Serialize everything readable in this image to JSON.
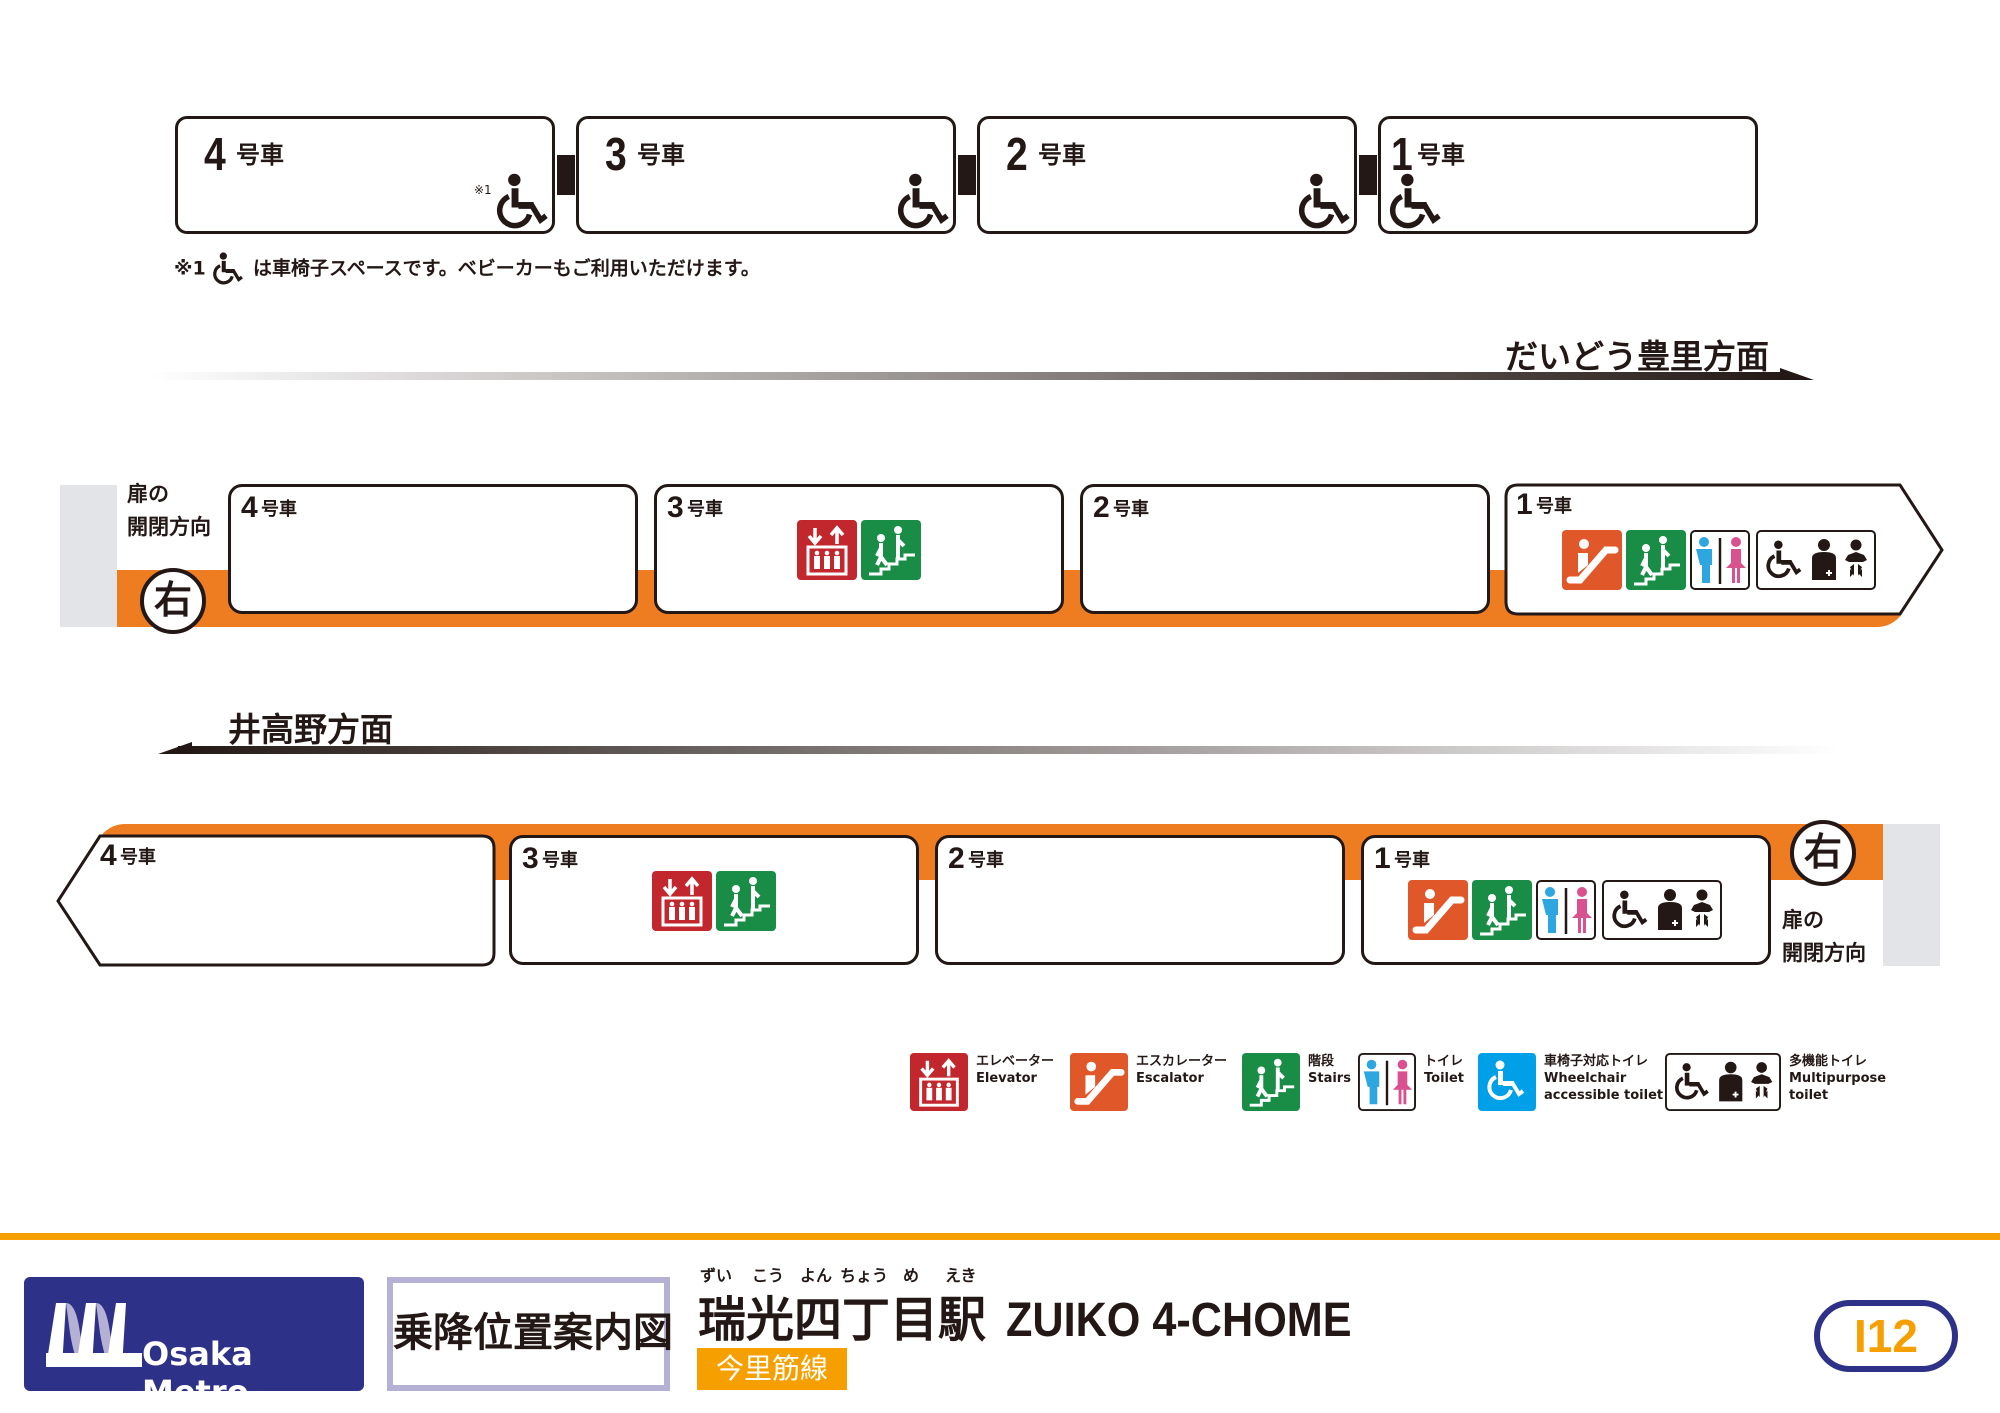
{
  "formation": {
    "cars": [
      {
        "num": "4",
        "suffix": "号車",
        "wheelchair": true,
        "note_mark": "※1"
      },
      {
        "num": "3",
        "suffix": "号車",
        "wheelchair": true
      },
      {
        "num": "2",
        "suffix": "号車",
        "wheelchair": true
      },
      {
        "num": "1",
        "suffix": "号車",
        "wheelchair": true
      }
    ],
    "note_prefix": "※1",
    "note_text": "は車椅子スペースです。ベビーカーもご利用いただけます。"
  },
  "platform_upper": {
    "direction": "だいどう豊里方面",
    "door_side_label_line1": "扉の",
    "door_side_label_line2": "開閉方向",
    "door_side": "右",
    "cars": [
      {
        "num": "4",
        "suffix": "号車",
        "facilities": []
      },
      {
        "num": "3",
        "suffix": "号車",
        "facilities": [
          "elevator",
          "stairs"
        ]
      },
      {
        "num": "2",
        "suffix": "号車",
        "facilities": []
      },
      {
        "num": "1",
        "suffix": "号車",
        "facilities": [
          "escalator",
          "stairs",
          "toilet",
          "multipurpose-toilet"
        ]
      }
    ]
  },
  "platform_lower": {
    "direction": "井高野方面",
    "door_side_label_line1": "扉の",
    "door_side_label_line2": "開閉方向",
    "door_side": "右",
    "cars": [
      {
        "num": "4",
        "suffix": "号車",
        "facilities": []
      },
      {
        "num": "3",
        "suffix": "号車",
        "facilities": [
          "elevator",
          "stairs"
        ]
      },
      {
        "num": "2",
        "suffix": "号車",
        "facilities": []
      },
      {
        "num": "1",
        "suffix": "号車",
        "facilities": [
          "escalator",
          "stairs",
          "toilet",
          "multipurpose-toilet"
        ]
      }
    ]
  },
  "legend": [
    {
      "icon": "elevator-icon",
      "ja": "エレベーター",
      "en": "Elevator"
    },
    {
      "icon": "escalator-icon",
      "ja": "エスカレーター",
      "en": "Escalator"
    },
    {
      "icon": "stairs-icon",
      "ja": "階段",
      "en": "Stairs"
    },
    {
      "icon": "toilet-icon",
      "ja": "トイレ",
      "en": "Toilet"
    },
    {
      "icon": "wheelchair-toilet-icon",
      "ja": "車椅子対応トイレ",
      "en": "Wheelchair",
      "en2": "accessible toilet"
    },
    {
      "icon": "multipurpose-toilet-icon",
      "ja": "多機能トイレ",
      "en": "Multipurpose",
      "en2": "toilet"
    }
  ],
  "footer": {
    "brand": "Osaka Metro",
    "guide_title": "乗降位置案内図",
    "ruby": [
      "ずい",
      "こう",
      "よん",
      "ちょう",
      "め",
      "えき"
    ],
    "station_ja": "瑞光四丁目駅",
    "station_en": "ZUIKO 4-CHOME",
    "line_name": "今里筋線",
    "station_number": "I12"
  },
  "colors": {
    "line_orange": "#ee7d22",
    "footer_yellow": "#f5a000",
    "metro_blue": "#2e3188",
    "elevator_red": "#c1272d",
    "escalator_orange": "#e0572a",
    "stairs_green": "#198c46",
    "toilet_male_blue": "#2ea7e0",
    "toilet_female_pink": "#d9528f",
    "wheelchair_toilet_blue": "#00a0e9",
    "wall_gray": "#e3e4e8"
  }
}
